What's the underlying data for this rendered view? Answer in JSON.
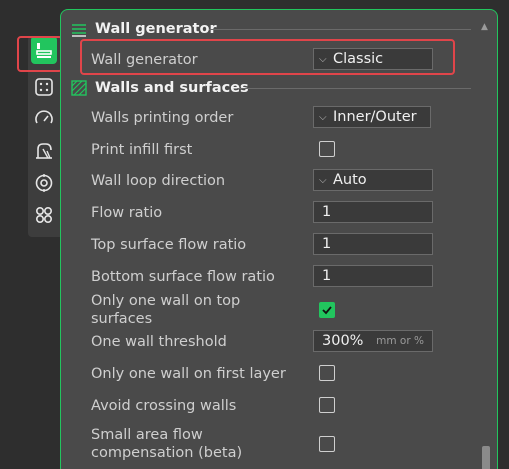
{
  "sidebar": {
    "items": [
      {
        "icon": "wall-layers-icon",
        "active": true
      },
      {
        "icon": "infill-grid-icon",
        "active": false
      },
      {
        "icon": "speed-gauge-icon",
        "active": false
      },
      {
        "icon": "support-icon",
        "active": false
      },
      {
        "icon": "multimaterial-icon",
        "active": false
      },
      {
        "icon": "others-icon",
        "active": false
      }
    ]
  },
  "sections": {
    "wall_generator": {
      "title": "Wall generator",
      "rows": {
        "wall_generator": {
          "label": "Wall generator",
          "value": "Classic"
        }
      }
    },
    "walls_and_surfaces": {
      "title": "Walls and surfaces",
      "rows": {
        "walls_printing_order": {
          "label": "Walls printing order",
          "value": "Inner/Outer"
        },
        "print_infill_first": {
          "label": "Print infill first",
          "checked": false
        },
        "wall_loop_direction": {
          "label": "Wall loop direction",
          "value": "Auto"
        },
        "flow_ratio": {
          "label": "Flow ratio",
          "value": "1"
        },
        "top_surface_flow_ratio": {
          "label": "Top surface flow ratio",
          "value": "1"
        },
        "bottom_surface_flow_ratio": {
          "label": "Bottom surface flow ratio",
          "value": "1"
        },
        "only_one_wall_top": {
          "label_line1": "Only one wall on top",
          "label_line2": "surfaces",
          "checked": true
        },
        "one_wall_threshold": {
          "label": "One wall threshold",
          "value": "300%",
          "unit": "mm or %"
        },
        "only_one_wall_first_layer": {
          "label": "Only one wall on first layer",
          "checked": false
        },
        "avoid_crossing_walls": {
          "label": "Avoid crossing walls",
          "checked": false
        },
        "small_area_flow_comp": {
          "label_line1": "Small area flow",
          "label_line2": "compensation (beta)",
          "checked": false
        }
      }
    }
  },
  "colors": {
    "accent": "#22c55e",
    "highlight": "#e0454a",
    "panel_bg": "#4a4a4a",
    "page_bg": "#2e2e2e"
  }
}
